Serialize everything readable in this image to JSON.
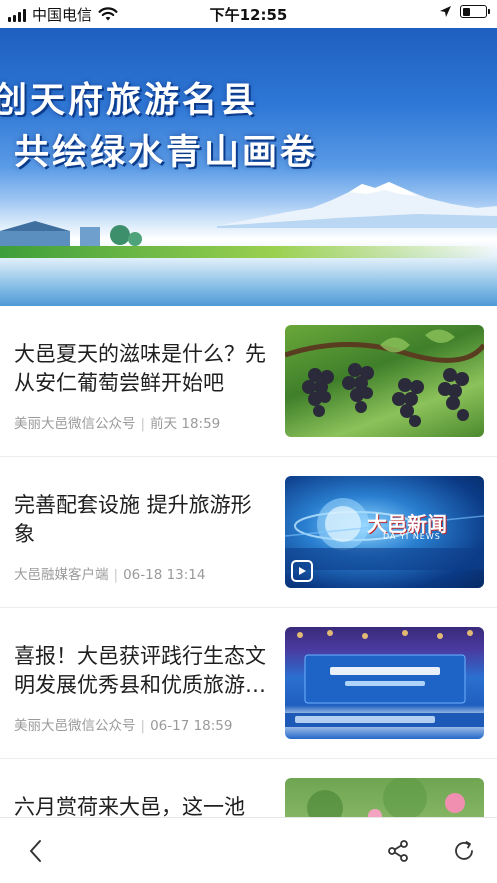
{
  "status_bar": {
    "carrier": "中国电信",
    "time": "下午12:55",
    "battery_level": 0.35,
    "icons": [
      "signal-icon",
      "wifi-icon",
      "location-arrow-icon",
      "battery-icon"
    ]
  },
  "banner": {
    "line1": "创天府旅游名县",
    "line2": "共绘绿水青山画卷"
  },
  "articles": [
    {
      "title": "大邑夏天的滋味是什么？先从安仁葡萄尝鲜开始吧",
      "source": "美丽大邑微信公众号",
      "time": "前天 18:59",
      "thumb": "grapes-photo"
    },
    {
      "title": "完善配套设施  提升旅游形象",
      "source": "大邑融媒客户端",
      "time": "06-18 13:14",
      "thumb": "news-video",
      "thumb_text": "大邑新闻",
      "thumb_subtext": "DA  YI  NEWS"
    },
    {
      "title": "喜报！大邑获评践行生态文明发展优秀县和优质旅游目的地",
      "source": "美丽大邑微信公众号",
      "time": "06-17 18:59",
      "thumb": "award-event-photo"
    },
    {
      "title": "六月赏荷来大邑，这一池",
      "source": "",
      "time": "",
      "thumb": "lotus-photo"
    }
  ],
  "toolbar": {
    "icons": [
      "back-chevron-icon",
      "share-icon",
      "refresh-icon"
    ]
  },
  "colors": {
    "banner_blue": "#2f78d6",
    "meta_gray": "#9a9a9a",
    "title_text": "#1f1f1f"
  }
}
